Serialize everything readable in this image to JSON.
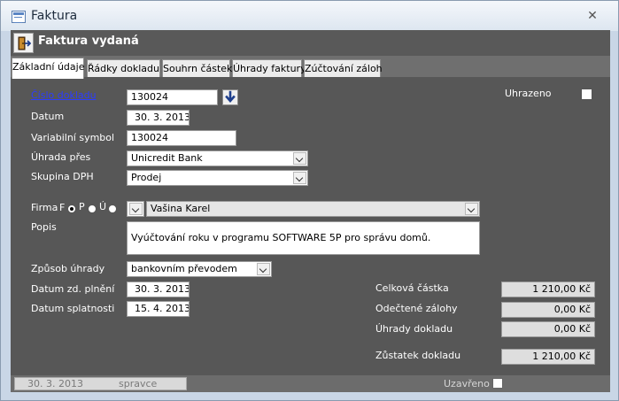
{
  "window": {
    "title": "Faktura"
  },
  "header": {
    "title": "Faktura vydaná"
  },
  "tabs": [
    {
      "label": "Základní údaje"
    },
    {
      "label": "Řádky dokladu"
    },
    {
      "label": "Souhrn částek"
    },
    {
      "label": "Úhrady faktury"
    },
    {
      "label": "Zúčtování záloh"
    }
  ],
  "form": {
    "cislo_dokladu": {
      "label": "Číslo dokladu",
      "value": "130024"
    },
    "datum": {
      "label": "Datum",
      "value": "30. 3. 2013"
    },
    "variabilni_symbol": {
      "label": "Variabilní symbol",
      "value": "130024"
    },
    "uhrada_pres": {
      "label": "Úhrada přes",
      "value": "Unicredit Bank"
    },
    "skupina_dph": {
      "label": "Skupina DPH",
      "value": "Prodej"
    },
    "uhrazeno": {
      "label": "Uhrazeno",
      "checked": false
    },
    "firma": {
      "label": "Firma",
      "radios": [
        {
          "label": "F",
          "checked": true
        },
        {
          "label": "P",
          "checked": false
        },
        {
          "label": "Ú",
          "checked": false
        }
      ],
      "value": "Vašina Karel"
    },
    "popis": {
      "label": "Popis",
      "value": "Vyúčtování roku v programu SOFTWARE 5P pro správu domů."
    },
    "zpusob_uhrady": {
      "label": "Způsob úhrady",
      "value": "bankovním převodem"
    },
    "datum_zd_plneni": {
      "label": "Datum zd. plnění",
      "value": "30. 3. 2013"
    },
    "datum_splatnosti": {
      "label": "Datum splatnosti",
      "value": "15. 4. 2013"
    }
  },
  "amounts": {
    "celkova_castka": {
      "label": "Celková částka",
      "value": "1 210,00 Kč"
    },
    "odectene_zalohy": {
      "label": "Odečtené zálohy",
      "value": "0,00 Kč"
    },
    "uhrady_dokladu": {
      "label": "Úhrady dokladu",
      "value": "0,00 Kč"
    },
    "zustatek_dokladu": {
      "label": "Zůstatek dokladu",
      "value": "1 210,00 Kč"
    }
  },
  "status": {
    "date": "30. 3. 2013",
    "user": "spravce",
    "uzavreno_label": "Uzavřeno",
    "uzavreno_checked": false
  },
  "colors": {
    "header_bg": "#595959",
    "panel_bg": "#575757",
    "link_label": "#2b3cff",
    "arrow_blue": "#1f3f8c"
  }
}
